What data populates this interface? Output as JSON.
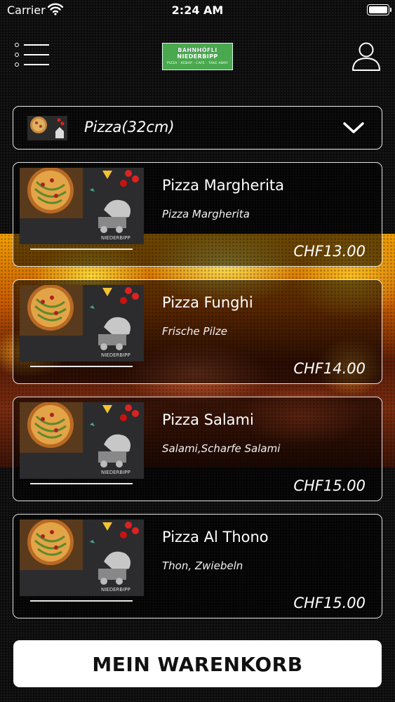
{
  "status_bar": {
    "carrier": "Carrier",
    "time": "2:24 AM",
    "wifi_icon": "wifi-icon",
    "battery_icon": "battery-icon"
  },
  "header": {
    "menu_icon": "menu-list-icon",
    "user_icon": "user-icon",
    "logo": {
      "line1": "BAHNHÖFLI",
      "line2": "NIEDERBIPP",
      "tagline": "PIZZA · KEBAP · CAFE · TAKE AWAY",
      "color": "#4aa84f"
    }
  },
  "category": {
    "label": "Pizza(32cm)",
    "icon": "chevron-down-icon"
  },
  "products": [
    {
      "name": "Pizza Margherita",
      "description": "Pizza Margherita",
      "price": "CHF13.00"
    },
    {
      "name": "Pizza Funghi",
      "description": "Frische Pilze",
      "price": "CHF14.00"
    },
    {
      "name": "Pizza Salami",
      "description": "Salami,Scharfe Salami",
      "price": "CHF15.00"
    },
    {
      "name": "Pizza Al Thono",
      "description": "Thon, Zwiebeln",
      "price": "CHF15.00"
    }
  ],
  "cart": {
    "label": "MEIN WARENKORB"
  }
}
